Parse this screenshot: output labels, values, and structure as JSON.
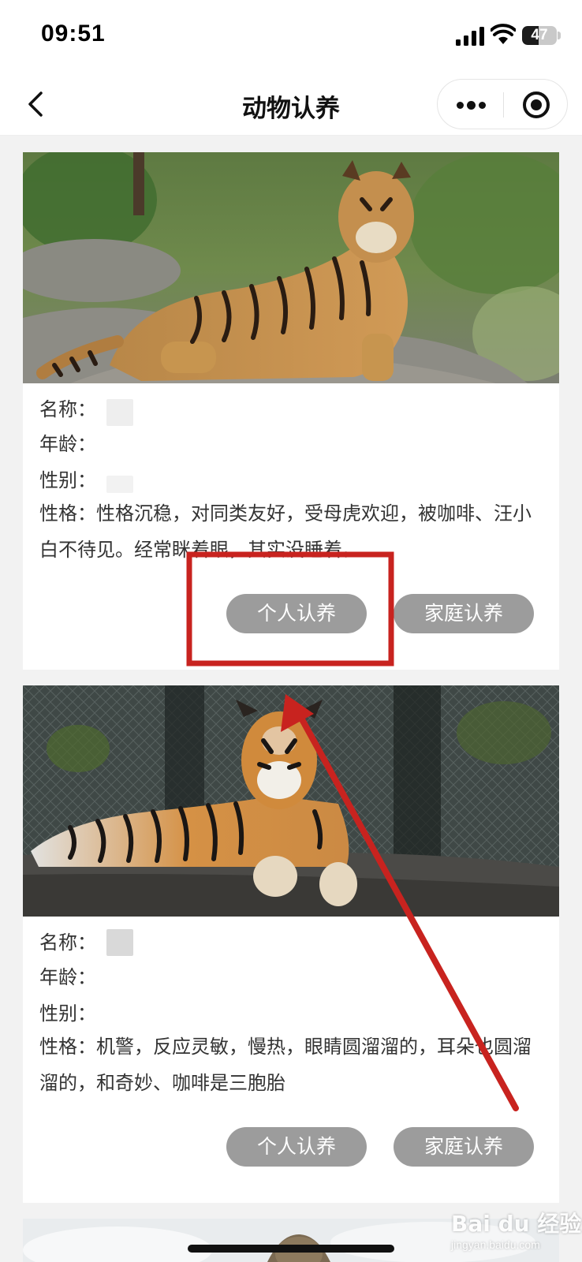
{
  "status_bar": {
    "time": "09:51",
    "battery": "47",
    "battery_level": 0.47
  },
  "nav": {
    "title": "动物认养"
  },
  "cards": [
    {
      "name_label": "名称：",
      "age_label": "年龄：",
      "gender_label": "性别：",
      "personality_label": "性格：",
      "personality": "性格沉稳，对同类友好，受母虎欢迎，被咖啡、汪小白不待见。经常眯着眼，其实没睡着。",
      "personal_adopt": "个人认养",
      "family_adopt": "家庭认养"
    },
    {
      "name_label": "名称：",
      "age_label": "年龄：",
      "gender_label": "性别：",
      "personality_label": "性格：",
      "personality": "机警，反应灵敏，慢热，眼睛圆溜溜的，耳朵也圆溜溜的，和奇妙、咖啡是三胞胎",
      "personal_adopt": "个人认养",
      "family_adopt": "家庭认养"
    }
  ],
  "annotation": {
    "color": "#c8231f"
  },
  "watermark": {
    "logo": "Bai du 经验",
    "sub": "jingyan.baidu.com"
  }
}
